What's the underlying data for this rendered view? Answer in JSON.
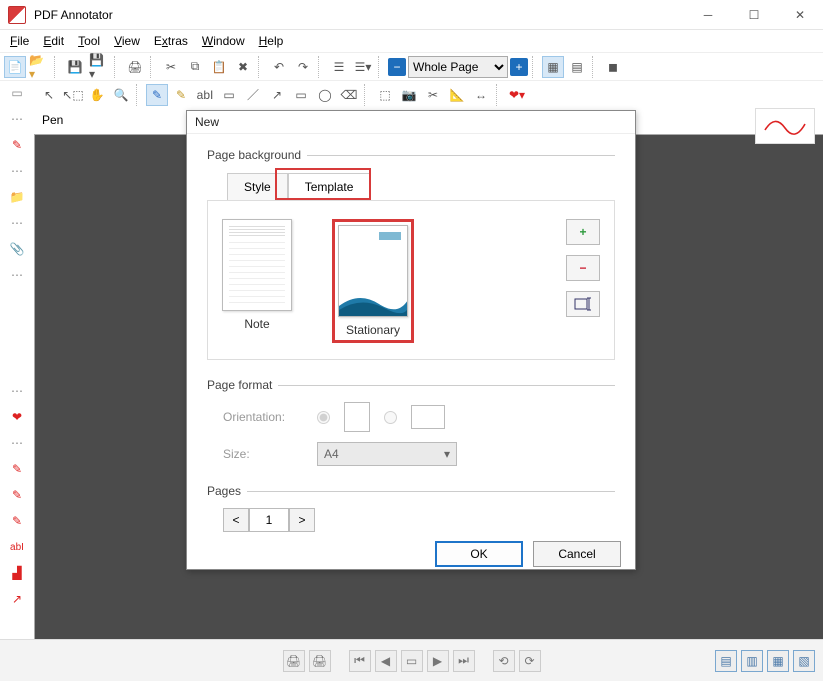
{
  "app": {
    "title": "PDF Annotator"
  },
  "menu": {
    "file": "File",
    "edit": "Edit",
    "tool": "Tool",
    "view": "View",
    "extras": "Extras",
    "window": "Window",
    "help": "Help"
  },
  "toolbar": {
    "zoom_mode": "Whole Page"
  },
  "pen_label": "Pen",
  "dialog": {
    "title": "New",
    "section_bg": "Page background",
    "tab_style": "Style",
    "tab_template": "Template",
    "tpl_note": "Note",
    "tpl_stationary": "Stationary",
    "section_format": "Page format",
    "orientation_label": "Orientation:",
    "size_label": "Size:",
    "size_value": "A4",
    "section_pages": "Pages",
    "pages_value": "1",
    "ok": "OK",
    "cancel": "Cancel"
  }
}
